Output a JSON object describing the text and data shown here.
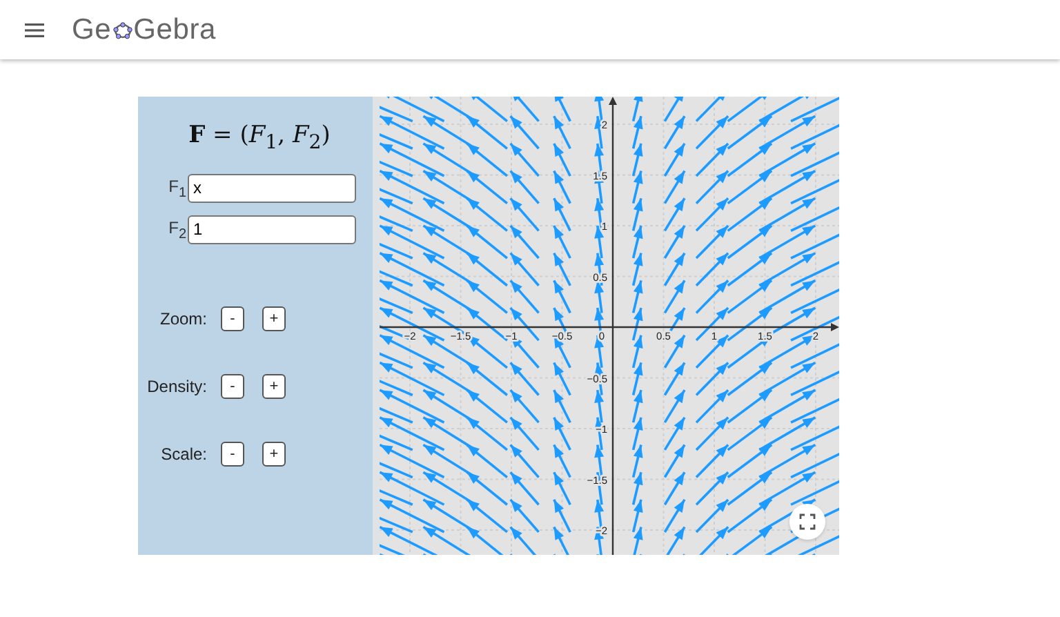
{
  "header": {
    "logo": {
      "before": "Ge",
      "after": "Gebra"
    }
  },
  "panel": {
    "formula": "**F** = (*F*$_{1}$, *F*$_{2}$)",
    "fields": [
      {
        "label": "F$_{1}$",
        "value": "x"
      },
      {
        "label": "F$_{2}$",
        "value": "1"
      }
    ],
    "controls": [
      {
        "label": "Zoom:",
        "minus": "-",
        "plus": "+"
      },
      {
        "label": "Density:",
        "minus": "-",
        "plus": "+"
      },
      {
        "label": "Scale:",
        "minus": "-",
        "plus": "+"
      }
    ]
  },
  "graph": {
    "x_ticks": [
      "−2",
      "−1.5",
      "−1",
      "−0.5",
      "0.5",
      "1",
      "1.5",
      "2"
    ],
    "y_ticks": [
      "2",
      "1.5",
      "1",
      "0.5",
      "−0.5",
      "−1",
      "−1.5",
      "−2"
    ],
    "origin": "0"
  }
}
